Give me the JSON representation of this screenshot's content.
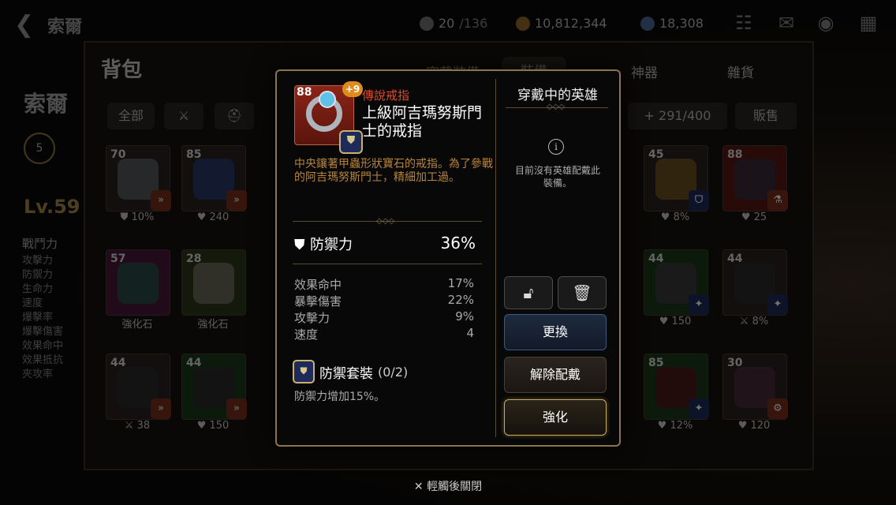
{
  "topbar": {
    "hero_name": "索爾",
    "stamina_value": "20",
    "stamina_max": "/136",
    "gold": "10,812,344",
    "crystal": "18,308"
  },
  "side": {
    "name": "索爾",
    "level": "Lv.59",
    "stat_header": "戰鬥力",
    "stats": [
      "攻擊力",
      "防禦力",
      "生命力",
      "速度",
      "爆擊率",
      "爆擊傷害",
      "效果命中",
      "效果抵抗",
      "夾攻率"
    ],
    "badge": "5"
  },
  "bag": {
    "title": "背包",
    "tabs": [
      "穿戴裝備",
      "裝備",
      "神器",
      "雜貨"
    ],
    "filter_all": "全部",
    "capacity": "291/400",
    "sell": "販售",
    "slots": [
      {
        "lv": "70",
        "stat": "10%",
        "icon": "shield-icon"
      },
      {
        "lv": "85",
        "stat": "240",
        "icon": "heart-icon"
      },
      {
        "lv": "45",
        "stat": "8%",
        "icon": "heart-icon"
      },
      {
        "lv": "88",
        "stat": "25",
        "icon": "heart-icon"
      },
      {
        "lv": "57",
        "stat": "強化石",
        "icon": ""
      },
      {
        "lv": "28",
        "stat": "強化石",
        "icon": ""
      },
      {
        "lv": "44",
        "stat": "150",
        "icon": "heart-icon"
      },
      {
        "lv": "44",
        "stat": "8%",
        "icon": "sword-icon"
      },
      {
        "lv": "44",
        "stat": "38",
        "icon": "sword-icon"
      },
      {
        "lv": "44",
        "stat": "150",
        "icon": "heart-icon"
      },
      {
        "lv": "85",
        "stat": "12%",
        "icon": "heart-icon"
      },
      {
        "lv": "30",
        "stat": "120",
        "icon": "heart-icon"
      }
    ]
  },
  "popup": {
    "item_level": "88",
    "enhance": "+9",
    "grade": "傳說戒指",
    "name": "上級阿吉瑪努斯門士的戒指",
    "description": "中央鑲著甲蟲形狀寶石的戒指。為了參戰的阿吉瑪努斯門士，精細加工過。",
    "main_stat": {
      "label": "防禦力",
      "value": "36%"
    },
    "sub_stats": [
      {
        "label": "效果命中",
        "value": "17%"
      },
      {
        "label": "暴擊傷害",
        "value": "22%"
      },
      {
        "label": "攻擊力",
        "value": "9%"
      },
      {
        "label": "速度",
        "value": "4"
      }
    ],
    "set": {
      "name": "防禦套裝",
      "count": "(0/2)",
      "desc": "防禦力增加15%。"
    },
    "right": {
      "title": "穿戴中的英雄",
      "empty_text": "目前沒有英雄配戴此裝備。",
      "buttons": {
        "replace": "更換",
        "unequip": "解除配戴",
        "enhance": "強化"
      }
    }
  },
  "close_hint": "輕觸後關閉",
  "colors": {
    "grade_red": "#e04a2a",
    "desc_gold": "#b7843c",
    "border_gold": "#8c7450"
  }
}
